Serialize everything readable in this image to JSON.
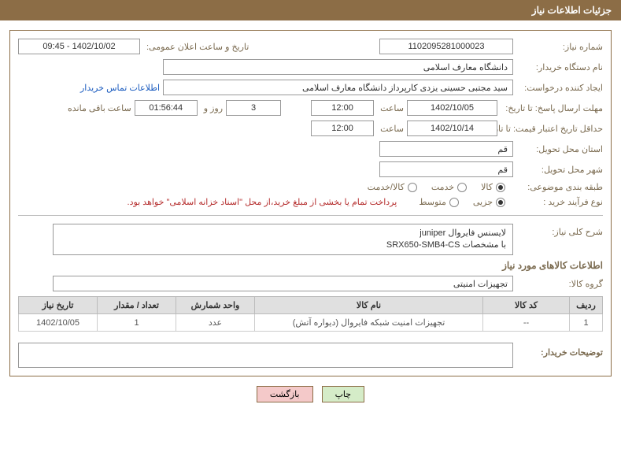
{
  "header": {
    "title": "جزئیات اطلاعات نیاز"
  },
  "fields": {
    "need_number_label": "شماره نیاز:",
    "need_number_value": "1102095281000023",
    "announce_label": "تاریخ و ساعت اعلان عمومی:",
    "announce_value": "1402/10/02 - 09:45",
    "buyer_org_label": "نام دستگاه خریدار:",
    "buyer_org_value": "دانشگاه معارف اسلامی",
    "requester_label": "ایجاد کننده درخواست:",
    "requester_value": "سید مجتبی حسینی یزدی کارپرداز دانشگاه معارف اسلامی",
    "contact_link": "اطلاعات تماس خریدار",
    "reply_deadline_label": "مهلت ارسال پاسخ: تا تاریخ:",
    "reply_deadline_date": "1402/10/05",
    "time_label": "ساعت",
    "reply_deadline_time": "12:00",
    "days_val": "3",
    "days_and": "روز و",
    "hours_val": "01:56:44",
    "remaining_label": "ساعت باقی مانده",
    "price_validity_label": "حداقل تاریخ اعتبار قیمت: تا تاریخ:",
    "price_validity_date": "1402/10/14",
    "price_validity_time": "12:00",
    "delivery_province_label": "استان محل تحویل:",
    "delivery_province_value": "قم",
    "delivery_city_label": "شهر محل تحویل:",
    "delivery_city_value": "قم",
    "subject_class_label": "طبقه بندی موضوعی:",
    "radio_goods": "کالا",
    "radio_service": "خدمت",
    "radio_goods_service": "کالا/خدمت",
    "purchase_type_label": "نوع فرآیند خرید :",
    "radio_small": "جزیی",
    "radio_medium": "متوسط",
    "payment_note": "پرداخت تمام یا بخشی از مبلغ خرید،از محل \"اسناد خزانه اسلامی\" خواهد بود.",
    "general_desc_label": "شرح کلی نیاز:",
    "general_desc_line1": "لایسنس فایروال juniper",
    "general_desc_line2": "با مشخصات  SRX650-SMB4-CS",
    "goods_info_title": "اطلاعات کالاهای مورد نیاز",
    "goods_group_label": "گروه کالا:",
    "goods_group_value": "تجهیزات امنیتی",
    "buyer_comments_label": "توضیحات خریدار:"
  },
  "table": {
    "headers": {
      "row": "ردیف",
      "code": "کد کالا",
      "name": "نام کالا",
      "unit": "واحد شمارش",
      "qty": "تعداد / مقدار",
      "date": "تاریخ نیاز"
    },
    "rows": [
      {
        "row": "1",
        "code": "--",
        "name": "تجهیزات امنیت شبکه فایروال (دیواره آتش)",
        "unit": "عدد",
        "qty": "1",
        "date": "1402/10/05"
      }
    ]
  },
  "buttons": {
    "print": "چاپ",
    "back": "بازگشت"
  }
}
